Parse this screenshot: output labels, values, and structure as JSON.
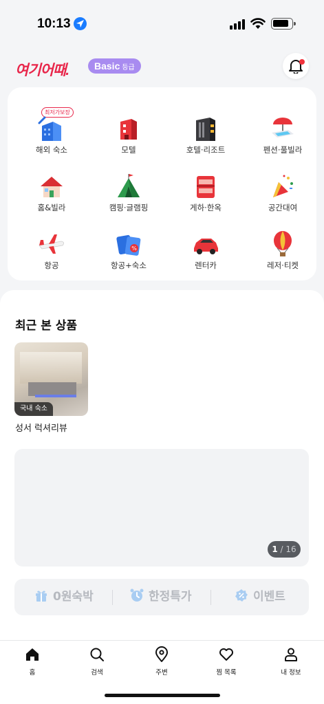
{
  "status_bar": {
    "time": "10:13"
  },
  "header": {
    "logo": "여기어때.",
    "grade_label": "Basic",
    "grade_suffix": "등급"
  },
  "categories": [
    {
      "label": "해외 숙소",
      "icon": "overseas-building-icon",
      "badge": "최저가보장"
    },
    {
      "label": "모텔",
      "icon": "motel-icon"
    },
    {
      "label": "호텔·리조트",
      "icon": "hotel-icon"
    },
    {
      "label": "펜션·풀빌라",
      "icon": "pension-pool-icon"
    },
    {
      "label": "홈&빌라",
      "icon": "house-icon"
    },
    {
      "label": "캠핑·글램핑",
      "icon": "tent-icon"
    },
    {
      "label": "게하·한옥",
      "icon": "bunk-bed-icon"
    },
    {
      "label": "공간대여",
      "icon": "party-popper-icon"
    },
    {
      "label": "항공",
      "icon": "airplane-icon"
    },
    {
      "label": "항공+숙소",
      "icon": "ticket-package-icon"
    },
    {
      "label": "렌터카",
      "icon": "rental-car-icon"
    },
    {
      "label": "레저·티켓",
      "icon": "hot-air-balloon-icon"
    }
  ],
  "recent": {
    "title": "최근 본 상품",
    "items": [
      {
        "tag": "국내 숙소",
        "name": "성서 럭셔리뷰"
      }
    ]
  },
  "banner": {
    "page_current": "1",
    "page_sep": " / ",
    "page_total": "16"
  },
  "quick_links": [
    {
      "label": "0원숙박",
      "icon": "gift-icon"
    },
    {
      "label": "한정특가",
      "icon": "alarm-clock-icon"
    },
    {
      "label": "이벤트",
      "icon": "discount-icon"
    }
  ],
  "tabs": [
    {
      "label": "홈",
      "icon": "home-icon"
    },
    {
      "label": "검색",
      "icon": "search-icon"
    },
    {
      "label": "주변",
      "icon": "map-pin-icon"
    },
    {
      "label": "찜 목록",
      "icon": "heart-icon"
    },
    {
      "label": "내 정보",
      "icon": "person-icon"
    }
  ],
  "colors": {
    "brand": "#e8264a",
    "grade": "#a88bf0",
    "notify_dot": "#f0323c"
  }
}
